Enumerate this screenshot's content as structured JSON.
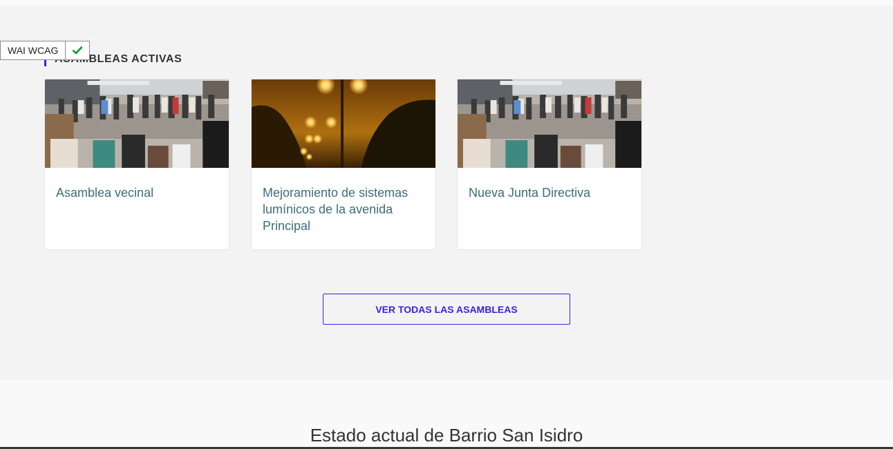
{
  "wai_badge": {
    "label": "WAI WCAG",
    "icon": "check-icon",
    "check_color": "#1a9a3a"
  },
  "assemblies": {
    "heading": "ASAMBLEAS ACTIVAS",
    "accent_color": "#3a1ee6",
    "cards": [
      {
        "title": "Asamblea vecinal",
        "image": "crowd-photo"
      },
      {
        "title": "Mejoramiento de sistemas lumínicos de la avenida Principal",
        "image": "street-lights-photo"
      },
      {
        "title": "Nueva Junta Directiva",
        "image": "crowd-photo"
      }
    ],
    "view_all_label": "VER TODAS LAS ASAMBLEAS"
  },
  "status": {
    "title": "Estado actual de Barrio San Isidro"
  }
}
